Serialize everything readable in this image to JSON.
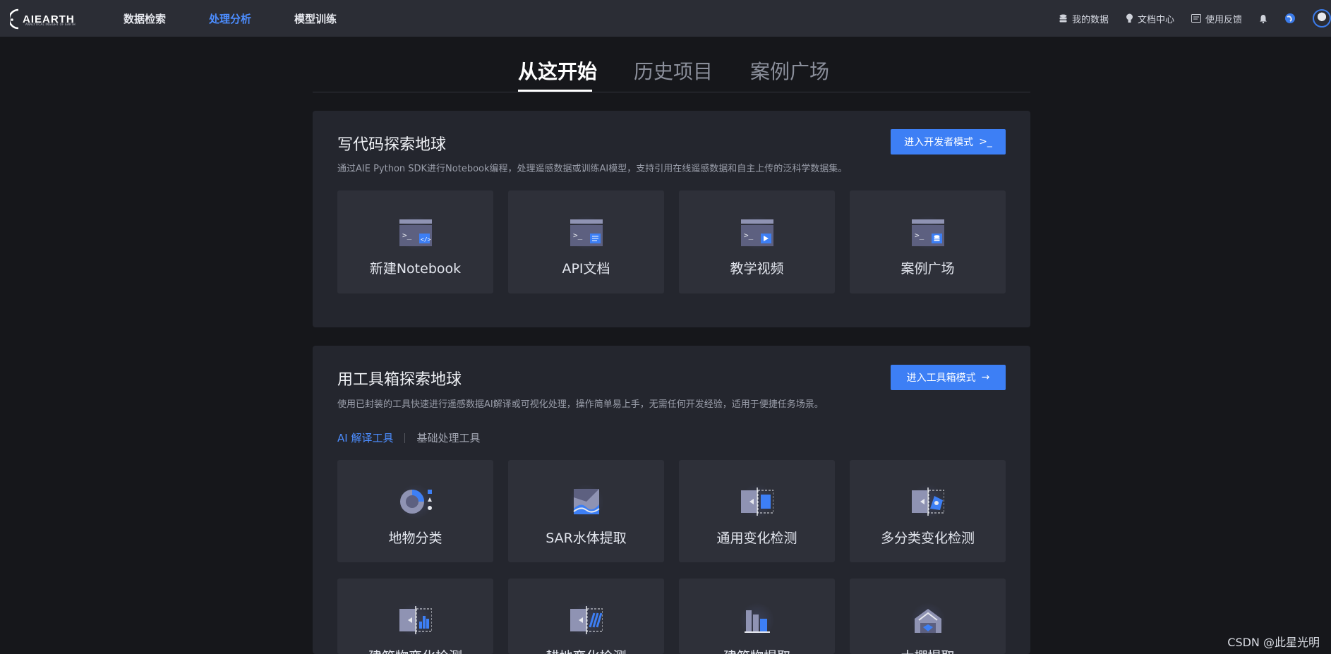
{
  "app": {
    "logo_text": "AIEARTH",
    "logo_subtext": "ANALYTICAL INSIGHT OF EARTH"
  },
  "nav": {
    "items": [
      {
        "label": "数据检索"
      },
      {
        "label": "处理分析"
      },
      {
        "label": "模型训练"
      }
    ],
    "active_index": 1
  },
  "top_right": {
    "my_data": "我的数据",
    "docs": "文档中心",
    "feedback": "使用反馈"
  },
  "tabs": {
    "items": [
      {
        "label": "从这开始"
      },
      {
        "label": "历史项目"
      },
      {
        "label": "案例广场"
      }
    ],
    "active_index": 0
  },
  "code_panel": {
    "title": "写代码探索地球",
    "description": "通过AIE Python SDK进行Notebook编程，处理遥感数据或训练AI模型，支持引用在线遥感数据和自主上传的泛科学数据集。",
    "cta_label": "进入开发者模式",
    "cards": [
      {
        "label": "新建Notebook",
        "icon": "notebook-code-icon"
      },
      {
        "label": "API文档",
        "icon": "api-doc-icon"
      },
      {
        "label": "教学视频",
        "icon": "video-icon"
      },
      {
        "label": "案例广场",
        "icon": "case-gallery-icon"
      }
    ]
  },
  "tool_panel": {
    "title": "用工具箱探索地球",
    "description": "使用已封装的工具快速进行遥感数据AI解译或可视化处理，操作简单易上手，无需任何开发经验，适用于便捷任务场景。",
    "cta_label": "进入工具箱模式",
    "subtabs": [
      {
        "label": "AI 解译工具"
      },
      {
        "label": "基础处理工具"
      }
    ],
    "cards_row1": [
      {
        "label": "地物分类",
        "icon": "land-cover-classification-icon"
      },
      {
        "label": "SAR水体提取",
        "icon": "sar-water-extraction-icon"
      },
      {
        "label": "通用变化检测",
        "icon": "change-detection-icon"
      },
      {
        "label": "多分类变化检测",
        "icon": "multi-class-change-icon"
      }
    ],
    "cards_row2": [
      {
        "label": "建筑物变化检测",
        "icon": "building-change-icon"
      },
      {
        "label": "耕地变化检测",
        "icon": "farmland-change-icon"
      },
      {
        "label": "建筑物提取",
        "icon": "building-extraction-icon"
      },
      {
        "label": "大棚提取",
        "icon": "greenhouse-extraction-icon"
      }
    ]
  },
  "watermark": "CSDN @此星光明",
  "colors": {
    "accent": "#3d7ff5",
    "nav_active": "#4c8dff",
    "background": "#16171b",
    "panel": "#24262e",
    "card": "#2e3039",
    "topbar": "#2b2d35"
  }
}
